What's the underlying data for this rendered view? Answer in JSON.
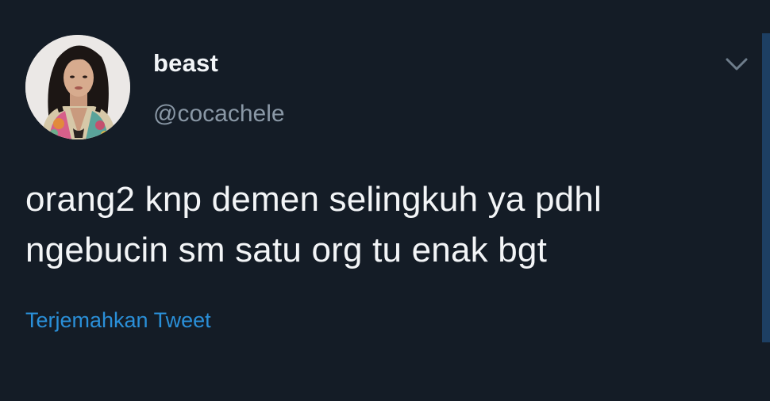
{
  "tweet": {
    "display_name": "beast",
    "handle": "@cocachele",
    "text_line_1": "orang2 knp demen selingkuh ya pdhl",
    "text_line_2": "ngebucin sm satu org tu enak bgt",
    "translate_label": "Terjemahkan Tweet",
    "more_icon": "chevron-down-icon",
    "avatar_icon": "profile-photo"
  },
  "colors": {
    "background": "#141c26",
    "text_primary": "#f3f5f7",
    "text_secondary": "#8a98a6",
    "link": "#2a8fd8"
  }
}
